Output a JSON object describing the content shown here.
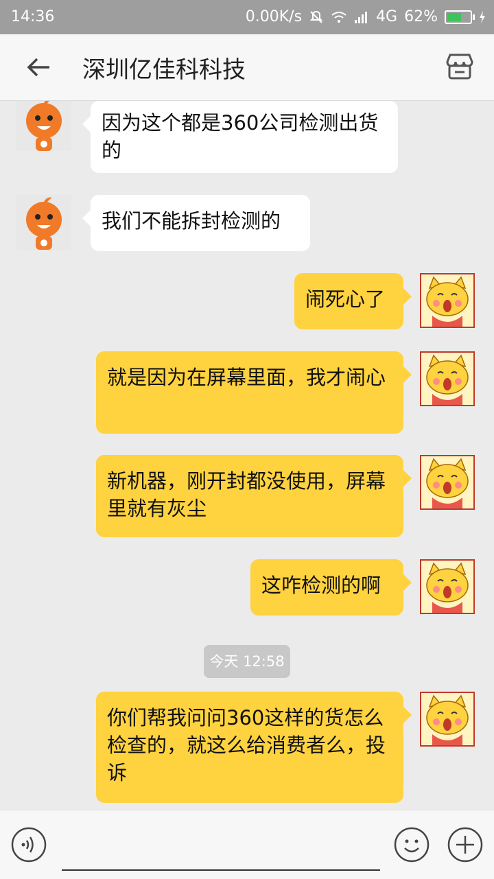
{
  "status": {
    "time": "14:36",
    "speed": "0.00K/s",
    "network": "4G",
    "battery": "62%",
    "battery_level": 0.62
  },
  "header": {
    "title": "深圳亿佳科科技"
  },
  "messages": [
    {
      "text": "因为这个都是360公司检测出货的"
    },
    {
      "text": "我们不能拆封检测的"
    },
    {
      "text": "闹死心了"
    },
    {
      "text": "就是因为在屏幕里面，我才闹心"
    },
    {
      "text": "新机器，刚开封都没使用，屏幕里就有灰尘"
    },
    {
      "text": "这咋检测的啊"
    },
    {
      "text": "你们帮我问问360这样的货怎么检查的，就这么给消费者么，投诉"
    }
  ],
  "timestamp": "今天 12:58",
  "input": {
    "placeholder": ""
  },
  "colors": {
    "right_bubble": "#ffd23f",
    "left_bubble": "#ffffff",
    "background": "#ebebeb"
  }
}
